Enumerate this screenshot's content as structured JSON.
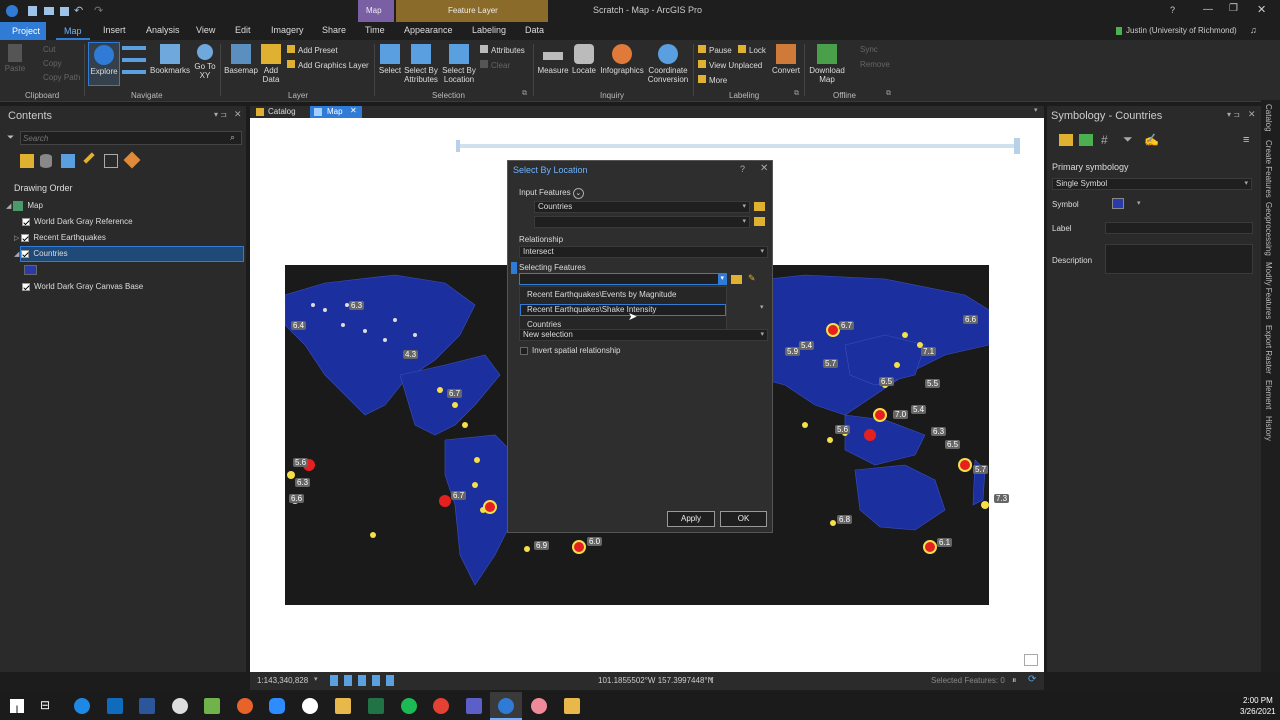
{
  "window": {
    "title": "Scratch - Map - ArcGIS Pro",
    "context_map": "Map",
    "context_feature_layer": "Feature Layer",
    "user": "Justin (University of Richmond)",
    "help": "?"
  },
  "ribbon_tabs": [
    "Project",
    "Map",
    "Insert",
    "Analysis",
    "View",
    "Edit",
    "Imagery",
    "Share",
    "Time",
    "Appearance",
    "Labeling",
    "Data"
  ],
  "ribbon": {
    "clipboard": {
      "label": "Clipboard",
      "paste": "Paste",
      "cut": "Cut",
      "copy": "Copy",
      "copy_path": "Copy Path"
    },
    "navigate": {
      "label": "Navigate",
      "explore": "Explore",
      "bookmarks": "Bookmarks",
      "goto": "Go To XY"
    },
    "layer": {
      "label": "Layer",
      "basemap": "Basemap",
      "add_data": "Add Data",
      "add_preset": "Add Preset",
      "add_graphics": "Add Graphics Layer"
    },
    "selection": {
      "label": "Selection",
      "select": "Select",
      "by_attributes": "Select By Attributes",
      "by_location": "Select By Location",
      "attributes": "Attributes",
      "clear": "Clear"
    },
    "inquiry": {
      "label": "Inquiry",
      "measure": "Measure",
      "locate": "Locate",
      "infographics": "Infographics",
      "coord": "Coordinate Conversion"
    },
    "labeling": {
      "label": "Labeling",
      "pause": "Pause",
      "lock": "Lock",
      "view_unplaced": "View Unplaced",
      "more": "More"
    },
    "offline": {
      "label": "Offline",
      "convert": "Convert",
      "download": "Download Map",
      "sync": "Sync",
      "remove": "Remove"
    }
  },
  "contents": {
    "title": "Contents",
    "search_placeholder": "Search",
    "drawing_order": "Drawing Order",
    "map": "Map",
    "layers": [
      {
        "name": "World Dark Gray Reference"
      },
      {
        "name": "Recent Earthquakes"
      },
      {
        "name": "Countries"
      },
      {
        "name": "World Dark Gray Canvas Base"
      }
    ]
  },
  "tabs": {
    "catalog": "Catalog",
    "map": "Map"
  },
  "dialog": {
    "title": "Select By Location",
    "help": "?",
    "input_features": "Input Features",
    "input_value": "Countries",
    "relationship_label": "Relationship",
    "relationship_value": "Intersect",
    "selecting_label": "Selecting Features",
    "dropdown": [
      "Recent Earthquakes\\Events by Magnitude",
      "Recent Earthquakes\\Shake Intensity",
      "Countries"
    ],
    "selection_type": "New selection",
    "invert": "Invert spatial relationship",
    "apply": "Apply",
    "ok": "OK"
  },
  "map_labels": [
    "6.3",
    "6.4",
    "4.3",
    "6.7",
    "5.6",
    "6.3",
    "6.6",
    "6.7",
    "6.9",
    "6.0",
    "6.7",
    "6.6",
    "5.9",
    "5.4",
    "5.7",
    "7.1",
    "6.5",
    "5.5",
    "7.0",
    "5.4",
    "5.6",
    "6.3",
    "6.5",
    "5.7",
    "6.8",
    "6.1",
    "7.3"
  ],
  "symbology": {
    "title": "Symbology - Countries",
    "primary": "Primary symbology",
    "single_symbol": "Single Symbol",
    "symbol": "Symbol",
    "label": "Label",
    "description": "Description",
    "symbol_color": "#2a3aa8"
  },
  "side_tabs": [
    "Catalog",
    "Create Features",
    "Geoprocessing",
    "Modify Features",
    "Export Raster",
    "Element",
    "History"
  ],
  "status": {
    "scale": "1:143,340,828",
    "coords": "101.1855502°W 157.3997448°N",
    "selected": "Selected Features: 0"
  },
  "taskbar": {
    "time": "2:00 PM",
    "date": "3/26/2021"
  },
  "colors": {
    "accent": "#2f7bd6",
    "map_blue": "#1c2f9e",
    "quake_yellow": "#f5e04a",
    "quake_red": "#e52020"
  }
}
